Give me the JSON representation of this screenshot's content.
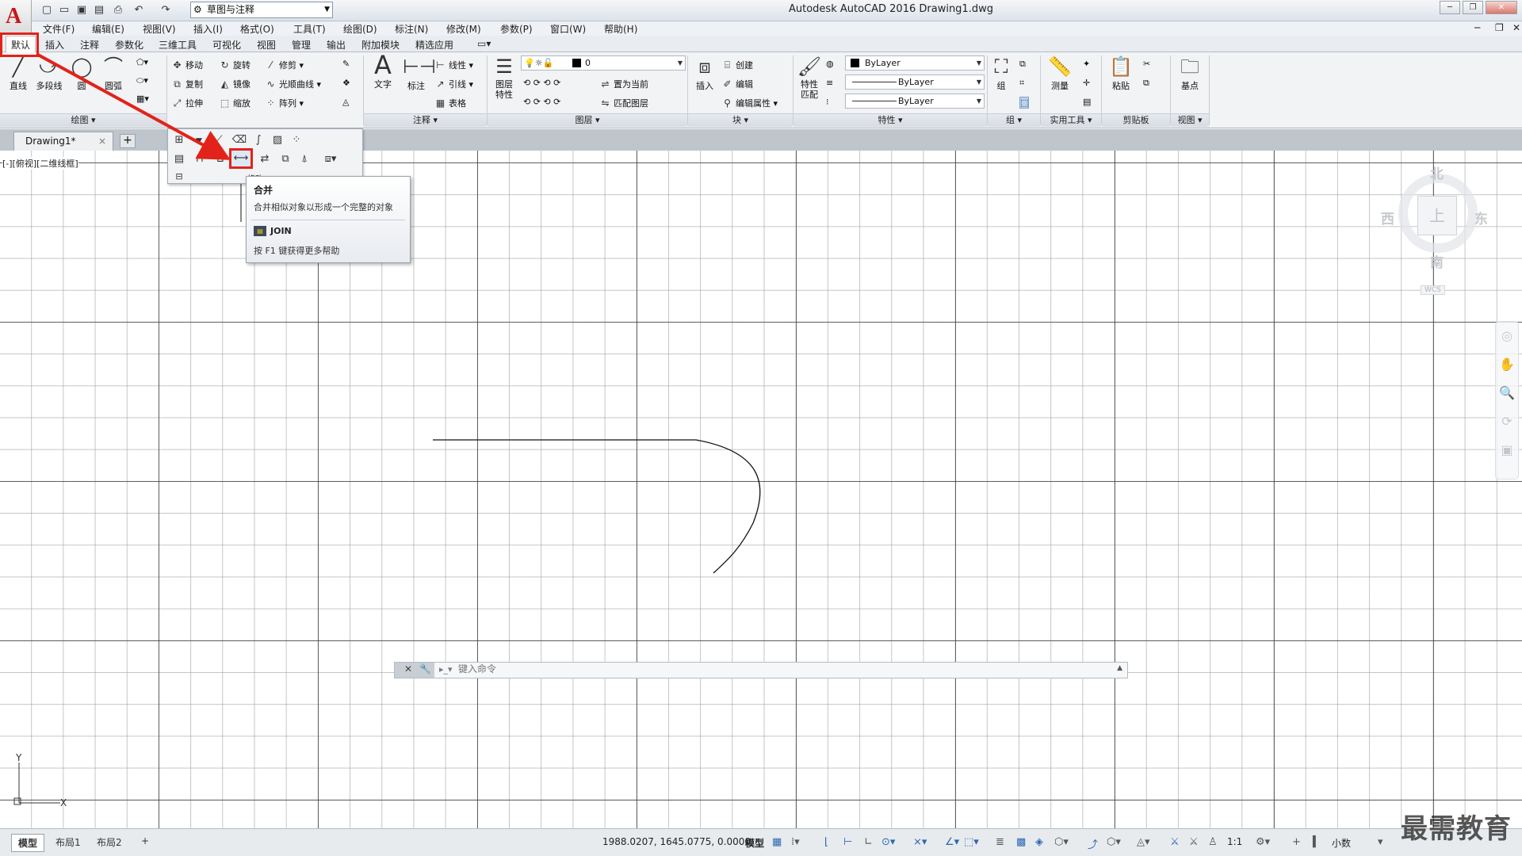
{
  "window": {
    "app_title": "Autodesk AutoCAD 2016    Drawing1.dwg",
    "workspace": "草图与注释",
    "controls": [
      "─",
      "❐",
      "✕"
    ]
  },
  "menu": [
    "文件(F)",
    "编辑(E)",
    "视图(V)",
    "插入(I)",
    "格式(O)",
    "工具(T)",
    "绘图(D)",
    "标注(N)",
    "修改(M)",
    "参数(P)",
    "窗口(W)",
    "帮助(H)"
  ],
  "ribbon_tabs": [
    "默认",
    "插入",
    "注释",
    "参数化",
    "三维工具",
    "可视化",
    "视图",
    "管理",
    "输出",
    "附加模块",
    "精选应用"
  ],
  "ribbon": {
    "draw": {
      "title": "绘图",
      "line": "直线",
      "polyline": "多段线",
      "circle": "圆",
      "arc": "圆弧"
    },
    "modify": {
      "move": "移动",
      "rotate": "旋转",
      "trim": "修剪",
      "copy": "复制",
      "mirror": "镜像",
      "fillet": "光顺曲线",
      "stretch": "拉伸",
      "scale": "缩放",
      "array": "阵列"
    },
    "annotation": {
      "title": "注释",
      "text": "文字",
      "dimension": "标注",
      "linear": "线性",
      "leader": "引线",
      "table": "表格"
    },
    "layers": {
      "title": "图层",
      "layer_props": "图层\n特性",
      "layer_value": "0",
      "set_current": "置为当前",
      "match_layer": "匹配图层"
    },
    "block": {
      "title": "块",
      "insert": "插入",
      "create": "创建",
      "edit": "编辑",
      "edit_attr": "编辑属性"
    },
    "properties": {
      "title": "特性",
      "match": "特性\n匹配",
      "color": "ByLayer",
      "linetype": "ByLayer",
      "lineweight": "ByLayer"
    },
    "groups": {
      "title": "组",
      "group": "组"
    },
    "utilities": {
      "title": "实用工具",
      "measure": "测量"
    },
    "clipboard": {
      "title": "剪贴板",
      "paste": "粘贴"
    },
    "view": {
      "title": "视图",
      "base": "基点"
    }
  },
  "doc_tab": {
    "name": "Drawing1*",
    "close": "×",
    "new": "+"
  },
  "viewport_label": "[-][俯视][二维线框]",
  "viewcube": {
    "north": "北",
    "south": "南",
    "east": "东",
    "west": "西",
    "face": "上",
    "wcs": "WCS"
  },
  "flyout": {
    "partial_label": "修改"
  },
  "tooltip": {
    "title": "合并",
    "description": "合并相似对象以形成一个完整的对象",
    "command": "JOIN",
    "help": "按 F1 键获得更多帮助"
  },
  "ucs": {
    "y": "Y",
    "x": "X"
  },
  "command_line": {
    "placeholder": "键入命令"
  },
  "layout_tabs": [
    "模型",
    "布局1",
    "布局2",
    "+"
  ],
  "status": {
    "coords": "1988.0207, 1645.0775, 0.0000",
    "model": "模型",
    "scale": "1:1",
    "units": "小数"
  },
  "watermark": "最需教育",
  "colors": {
    "accent_red": "#e2231a",
    "autocad_red": "#c8161d",
    "status_blue": "#2a67b3"
  }
}
